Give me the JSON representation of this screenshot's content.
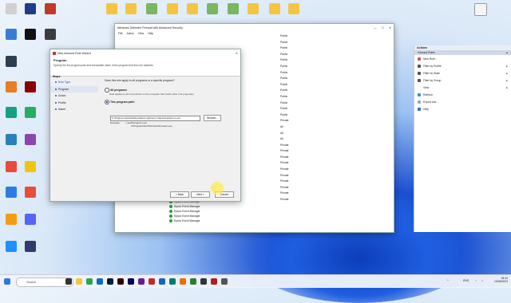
{
  "desktop": {
    "icons": [
      {
        "label": "",
        "color": "#9a9a9a"
      },
      {
        "label": "",
        "color": "#1f3d8a"
      },
      {
        "label": "",
        "color": "#c0392b"
      },
      {
        "label": "",
        "color": "#3c3c3c"
      },
      {
        "label": "",
        "color": "#3a7bd5"
      },
      {
        "label": "",
        "color": "#111111"
      },
      {
        "label": "",
        "color": "#2c3e50"
      },
      {
        "label": "",
        "color": "#e67e22"
      },
      {
        "label": "",
        "color": "#16a085"
      },
      {
        "label": "",
        "color": "#8e44ad"
      },
      {
        "label": "",
        "color": "#ffffff"
      },
      {
        "label": "",
        "color": "#2980b9"
      },
      {
        "label": "",
        "color": "#e74c3c"
      },
      {
        "label": "",
        "color": "#f1c40f"
      },
      {
        "label": "",
        "color": "#5865f2"
      },
      {
        "label": "",
        "color": "#2980b9"
      }
    ],
    "top_icons": [
      "",
      "",
      "",
      "",
      "",
      "",
      "",
      "",
      "",
      "",
      ""
    ]
  },
  "main_window": {
    "title": "Windows Defender Firewall with Advanced Security",
    "menu": [
      "File",
      "Action",
      "View",
      "Help"
    ]
  },
  "actions_panel": {
    "header": "Actions",
    "subheader": "Inbound Rules",
    "items": [
      "New Rule...",
      "Filter by Profile",
      "Filter by State",
      "Filter by Group",
      "View",
      "Refresh",
      "Export List...",
      "Help"
    ]
  },
  "profiles": [
    "Public",
    "Public",
    "Public",
    "Public",
    "Public",
    "Public",
    "Public",
    "Public",
    "Public",
    "Public",
    "Public",
    "Public",
    "Public",
    "Public",
    "Private",
    "All",
    "All",
    "All",
    "Private",
    "Private",
    "Private",
    "Private",
    "Private",
    "Private",
    "Private",
    "Private",
    "Private",
    "Private"
  ],
  "rule_list": [
    "Epson Event Manager",
    "Epson Event Manager",
    "Epson Event Manager",
    "Epson Event Manager",
    "Epson Event Manager"
  ],
  "wizard": {
    "title": "New Inbound Rule Wizard",
    "heading": "Program",
    "subtitle": "Specify the full program path and executable name of the program that this rule matches.",
    "steps_header": "Steps:",
    "steps": [
      "Rule Type",
      "Program",
      "Action",
      "Profile",
      "Name"
    ],
    "question": "Does this rule apply to all programs or a specific program?",
    "all_programs": "All programs",
    "all_programs_desc": "Rule applies to all connections on the computer that match other rule properties.",
    "this_program": "This program path:",
    "path_value": "C:\\Program Files\\Adobe\\Adobe Lightroom Classic\\Lightroom.exe",
    "browse": "Browse...",
    "example_label": "Example:",
    "example_1": "c:\\path\\program.exe",
    "example_2": "%ProgramFiles%\\browser\\browser.exe",
    "back": "< Back",
    "next": "Next >",
    "cancel": "Cancel"
  },
  "taskbar": {
    "search_placeholder": "Search",
    "lang": "ENG",
    "time": "18:34",
    "date": "13/06/2024"
  }
}
